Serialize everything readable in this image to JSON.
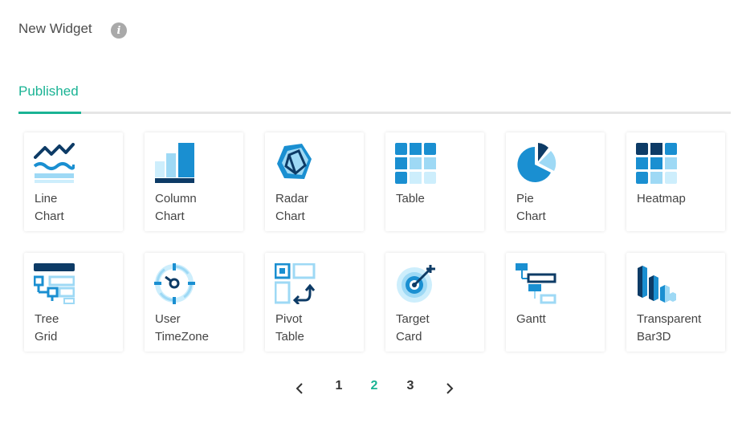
{
  "header": {
    "title": "New Widget",
    "info_icon": "info-icon"
  },
  "tabs": [
    {
      "label": "Published",
      "active": true
    }
  ],
  "widgets": [
    {
      "line1": "Line",
      "line2": "Chart",
      "icon": "line-chart-icon"
    },
    {
      "line1": "Column",
      "line2": "Chart",
      "icon": "column-chart-icon"
    },
    {
      "line1": "Radar",
      "line2": "Chart",
      "icon": "radar-chart-icon"
    },
    {
      "line1": "Table",
      "line2": "",
      "icon": "table-icon"
    },
    {
      "line1": "Pie",
      "line2": "Chart",
      "icon": "pie-chart-icon"
    },
    {
      "line1": "Heatmap",
      "line2": "",
      "icon": "heatmap-icon"
    },
    {
      "line1": "Tree",
      "line2": "Grid",
      "icon": "tree-grid-icon"
    },
    {
      "line1": "User",
      "line2": "TimeZone",
      "icon": "timezone-icon"
    },
    {
      "line1": "Pivot",
      "line2": "Table",
      "icon": "pivot-table-icon"
    },
    {
      "line1": "Target",
      "line2": "Card",
      "icon": "target-card-icon"
    },
    {
      "line1": "Gantt",
      "line2": "",
      "icon": "gantt-icon"
    },
    {
      "line1": "Transparent",
      "line2": "Bar3D",
      "icon": "bar3d-icon"
    }
  ],
  "pagination": {
    "prev_icon": "chevron-left-icon",
    "pages": [
      "1",
      "2",
      "3"
    ],
    "current": "2",
    "next_icon": "chevron-right-icon"
  },
  "colors": {
    "accent": "#1ab394",
    "dark_blue": "#0d3b66",
    "mid_blue": "#1a8fd1",
    "light_blue": "#9ed9f5",
    "pale_blue": "#cdeefc"
  }
}
